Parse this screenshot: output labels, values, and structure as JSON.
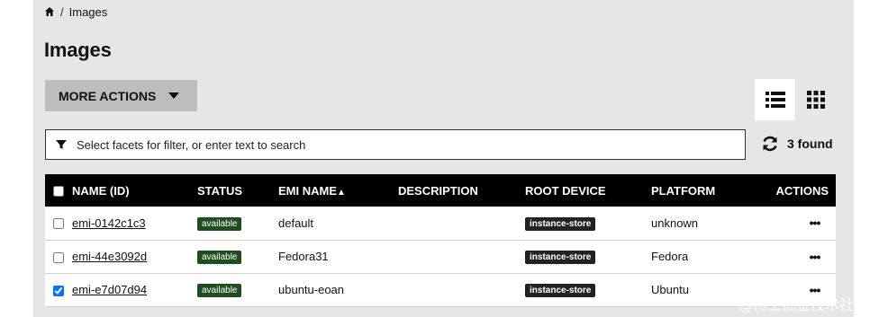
{
  "breadcrumb": {
    "home_icon": "home-icon",
    "separator": "/",
    "current": "Images"
  },
  "page": {
    "title": "Images"
  },
  "toolbar": {
    "more_actions_label": "MORE ACTIONS",
    "list_view_icon": "list-view-icon",
    "grid_view_icon": "grid-view-icon"
  },
  "search": {
    "placeholder": "Select facets for filter, or enter text to search",
    "value": ""
  },
  "results": {
    "found_label": "3 found"
  },
  "table": {
    "columns": [
      "NAME (ID)",
      "STATUS",
      "EMI NAME",
      "DESCRIPTION",
      "ROOT DEVICE",
      "PLATFORM",
      "ACTIONS"
    ],
    "sort_indicator": "▲",
    "rows": [
      {
        "checked": false,
        "id": "emi-0142c1c3",
        "status": "available",
        "emi_name": "default",
        "description": "",
        "root_device": "instance-store",
        "platform": "unknown",
        "actions": "•••"
      },
      {
        "checked": false,
        "id": "emi-44e3092d",
        "status": "available",
        "emi_name": "Fedora31",
        "description": "",
        "root_device": "instance-store",
        "platform": "Fedora",
        "actions": "•••"
      },
      {
        "checked": true,
        "id": "emi-e7d07d94",
        "status": "available",
        "emi_name": "ubuntu-eoan",
        "description": "",
        "root_device": "instance-store",
        "platform": "Ubuntu",
        "actions": "•••"
      }
    ]
  },
  "watermark": "@稀土掘金技术社区",
  "colors": {
    "panel": "#e6e6e6",
    "header_bg": "#000000",
    "status_badge": "#1e4d1e",
    "root_badge": "#222222",
    "button_bg": "#bdbdbd"
  }
}
